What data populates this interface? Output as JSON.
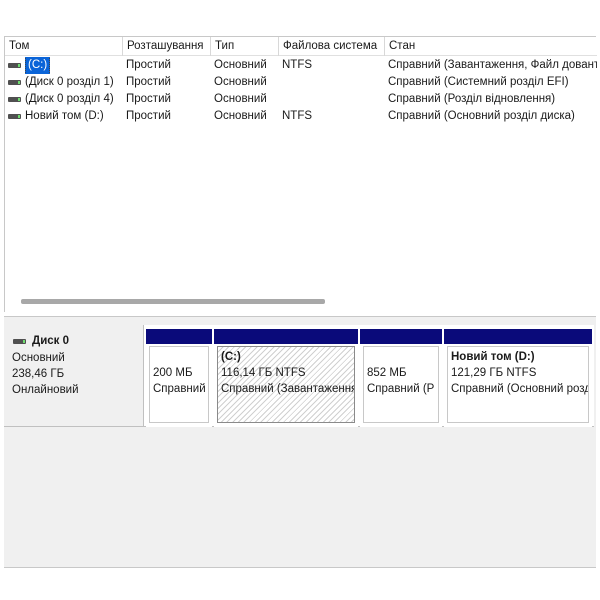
{
  "columns": [
    "Том",
    "Розташування",
    "Тип",
    "Файлова система",
    "Стан"
  ],
  "volumes": [
    {
      "name": "(C:)",
      "layout": "Простий",
      "type": "Основний",
      "fs": "NTFS",
      "status": "Справний (Завантаження, Файл довантаження)",
      "selected": true
    },
    {
      "name": "(Диск 0 розділ 1)",
      "layout": "Простий",
      "type": "Основний",
      "fs": "",
      "status": "Справний (Системний розділ EFI)",
      "selected": false
    },
    {
      "name": "(Диск 0 розділ 4)",
      "layout": "Простий",
      "type": "Основний",
      "fs": "",
      "status": "Справний (Розділ відновлення)",
      "selected": false
    },
    {
      "name": "Новий том (D:)",
      "layout": "Простий",
      "type": "Основний",
      "fs": "NTFS",
      "status": "Справний (Основний розділ диска)",
      "selected": false
    }
  ],
  "disk": {
    "title": "Диск 0",
    "type": "Основний",
    "size": "238,46 ГБ",
    "state": "Онлайновий"
  },
  "partitions": [
    {
      "name": "",
      "size": "200 МБ",
      "status": "Справний"
    },
    {
      "name": "(C:)",
      "size": "116,14 ГБ NTFS",
      "status": "Справний (Завантаження"
    },
    {
      "name": "",
      "size": "852 МБ",
      "status": "Справний (Р"
    },
    {
      "name": "Новий том  (D:)",
      "size": "121,29 ГБ NTFS",
      "status": "Справний (Основний розділ"
    }
  ],
  "colors": {
    "partition_header": "#0a0a7a",
    "selection": "#0a64d8",
    "volume_icon_indicator": "#6fdc6f"
  },
  "icons": {
    "volume": "disk-volume-icon"
  }
}
